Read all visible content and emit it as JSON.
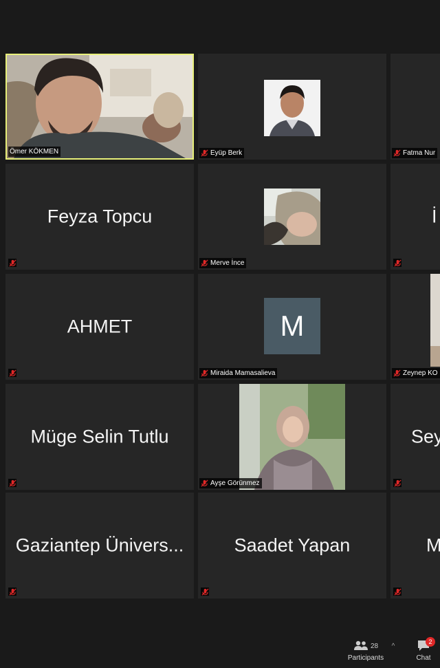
{
  "participants": [
    {
      "name": "Ömer KÖKMEN",
      "type": "video",
      "active": true,
      "muted": false
    },
    {
      "name": "Eyüp Berk",
      "type": "photo",
      "muted": true
    },
    {
      "name": "Fatma Nur",
      "type": "dark",
      "muted": true
    },
    {
      "name": "Feyza Topcu",
      "type": "name",
      "muted": true
    },
    {
      "name": "Merve İnce",
      "type": "photo",
      "muted": true
    },
    {
      "name": "İ",
      "type": "name",
      "muted": true
    },
    {
      "name": "AHMET",
      "type": "name",
      "muted": true
    },
    {
      "name": "Miraida Mamasalieva",
      "type": "initial",
      "initial": "M",
      "muted": true
    },
    {
      "name": "Zeynep KO",
      "type": "photo",
      "muted": true
    },
    {
      "name": "Müge Selin Tutlu",
      "type": "name",
      "muted": true
    },
    {
      "name": "Ayşe Görünmez",
      "type": "photo",
      "muted": true
    },
    {
      "name": "Sey",
      "type": "name",
      "muted": true
    },
    {
      "name": "Gaziantep Ünivers...",
      "type": "name",
      "muted": true
    },
    {
      "name": "Saadet Yapan",
      "type": "name",
      "muted": true
    },
    {
      "name": "M",
      "type": "name",
      "muted": true
    }
  ],
  "toolbar": {
    "participants_count": "28",
    "participants_label": "Participants",
    "chat_label": "Chat",
    "chat_badge": "2"
  },
  "colors": {
    "active_border": "#e8f07a",
    "mute_icon": "#e02828",
    "tile_bg": "#262626",
    "background": "#1a1a1a"
  }
}
